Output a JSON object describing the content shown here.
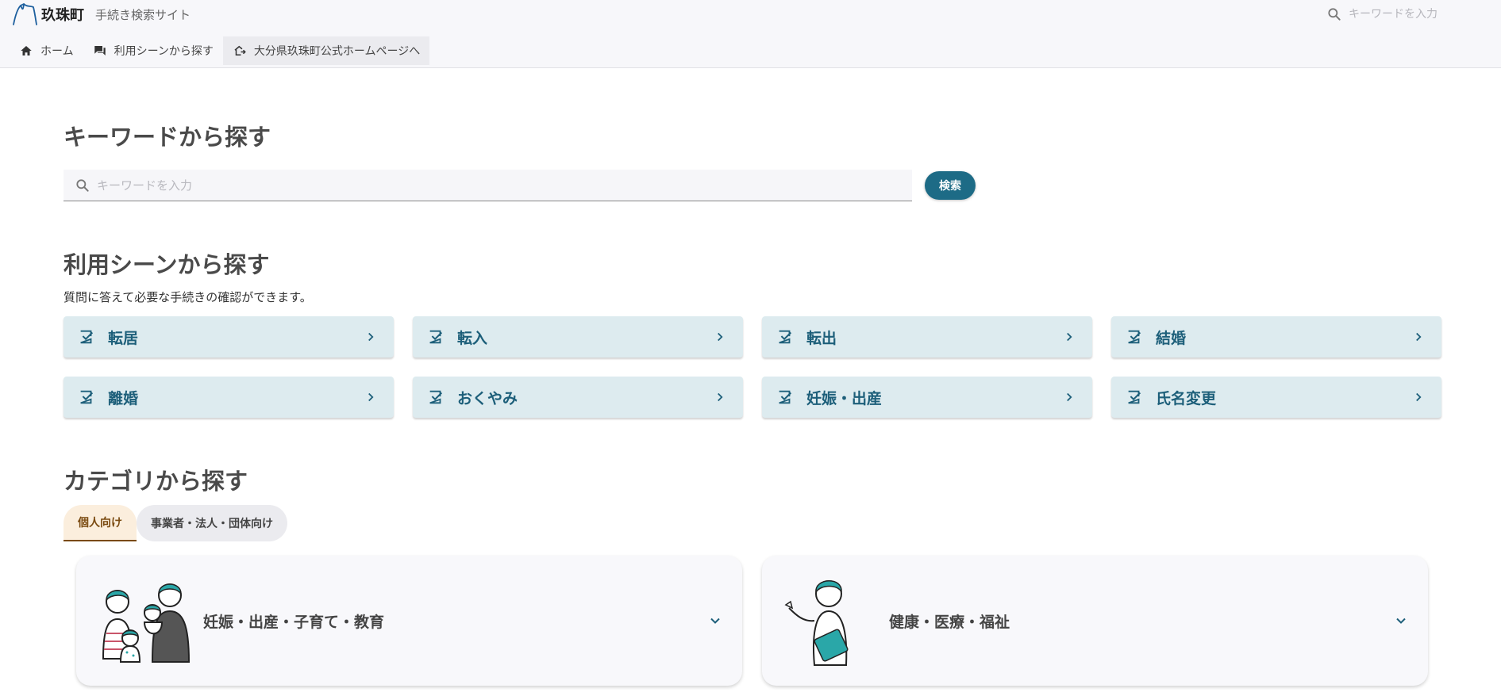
{
  "header": {
    "brand_name": "玖珠町",
    "brand_sub": "手続き検索サイト",
    "search_placeholder": "キーワードを入力",
    "nav": [
      {
        "label": "ホーム",
        "icon": "home-icon"
      },
      {
        "label": "利用シーンから探す",
        "icon": "forum-icon"
      },
      {
        "label": "大分県玖珠町公式ホームページへ",
        "icon": "external-home-icon"
      }
    ]
  },
  "keyword_section": {
    "title": "キーワードから探す",
    "placeholder": "キーワードを入力",
    "button_label": "検索"
  },
  "scene_section": {
    "title": "利用シーンから探す",
    "description": "質問に答えて必要な手続きの確認ができます。",
    "items": [
      "転居",
      "転入",
      "転出",
      "結婚",
      "離婚",
      "おくやみ",
      "妊娠・出産",
      "氏名変更"
    ]
  },
  "category_section": {
    "title": "カテゴリから探す",
    "tabs": [
      {
        "label": "個人向け",
        "active": true
      },
      {
        "label": "事業者・法人・団体向け",
        "active": false
      }
    ],
    "cards": [
      {
        "label": "妊娠・出産・子育て・教育",
        "icon": "family-illustration"
      },
      {
        "label": "健康・医療・福祉",
        "icon": "nurse-illustration"
      }
    ]
  },
  "colors": {
    "accent": "#1d6b86",
    "scene_card_bg": "#ddebef",
    "scene_text": "#1d5f7a",
    "tab_active_bg": "#fbeedd",
    "illustration_teal": "#2aa7a8"
  }
}
